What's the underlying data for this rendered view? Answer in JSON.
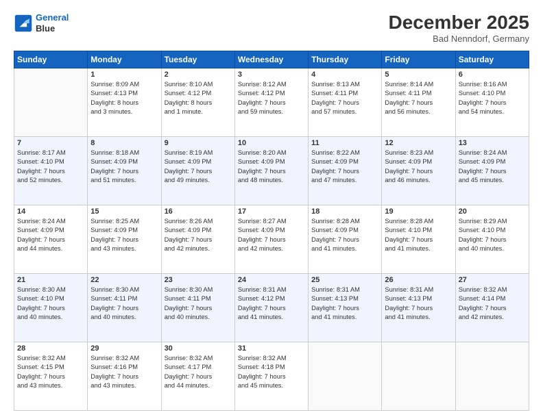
{
  "header": {
    "logo_line1": "General",
    "logo_line2": "Blue",
    "title": "December 2025",
    "subtitle": "Bad Nenndorf, Germany"
  },
  "days_of_week": [
    "Sunday",
    "Monday",
    "Tuesday",
    "Wednesday",
    "Thursday",
    "Friday",
    "Saturday"
  ],
  "weeks": [
    [
      {
        "day": "",
        "info": ""
      },
      {
        "day": "1",
        "info": "Sunrise: 8:09 AM\nSunset: 4:13 PM\nDaylight: 8 hours\nand 3 minutes."
      },
      {
        "day": "2",
        "info": "Sunrise: 8:10 AM\nSunset: 4:12 PM\nDaylight: 8 hours\nand 1 minute."
      },
      {
        "day": "3",
        "info": "Sunrise: 8:12 AM\nSunset: 4:12 PM\nDaylight: 7 hours\nand 59 minutes."
      },
      {
        "day": "4",
        "info": "Sunrise: 8:13 AM\nSunset: 4:11 PM\nDaylight: 7 hours\nand 57 minutes."
      },
      {
        "day": "5",
        "info": "Sunrise: 8:14 AM\nSunset: 4:11 PM\nDaylight: 7 hours\nand 56 minutes."
      },
      {
        "day": "6",
        "info": "Sunrise: 8:16 AM\nSunset: 4:10 PM\nDaylight: 7 hours\nand 54 minutes."
      }
    ],
    [
      {
        "day": "7",
        "info": "Sunrise: 8:17 AM\nSunset: 4:10 PM\nDaylight: 7 hours\nand 52 minutes."
      },
      {
        "day": "8",
        "info": "Sunrise: 8:18 AM\nSunset: 4:09 PM\nDaylight: 7 hours\nand 51 minutes."
      },
      {
        "day": "9",
        "info": "Sunrise: 8:19 AM\nSunset: 4:09 PM\nDaylight: 7 hours\nand 49 minutes."
      },
      {
        "day": "10",
        "info": "Sunrise: 8:20 AM\nSunset: 4:09 PM\nDaylight: 7 hours\nand 48 minutes."
      },
      {
        "day": "11",
        "info": "Sunrise: 8:22 AM\nSunset: 4:09 PM\nDaylight: 7 hours\nand 47 minutes."
      },
      {
        "day": "12",
        "info": "Sunrise: 8:23 AM\nSunset: 4:09 PM\nDaylight: 7 hours\nand 46 minutes."
      },
      {
        "day": "13",
        "info": "Sunrise: 8:24 AM\nSunset: 4:09 PM\nDaylight: 7 hours\nand 45 minutes."
      }
    ],
    [
      {
        "day": "14",
        "info": "Sunrise: 8:24 AM\nSunset: 4:09 PM\nDaylight: 7 hours\nand 44 minutes."
      },
      {
        "day": "15",
        "info": "Sunrise: 8:25 AM\nSunset: 4:09 PM\nDaylight: 7 hours\nand 43 minutes."
      },
      {
        "day": "16",
        "info": "Sunrise: 8:26 AM\nSunset: 4:09 PM\nDaylight: 7 hours\nand 42 minutes."
      },
      {
        "day": "17",
        "info": "Sunrise: 8:27 AM\nSunset: 4:09 PM\nDaylight: 7 hours\nand 42 minutes."
      },
      {
        "day": "18",
        "info": "Sunrise: 8:28 AM\nSunset: 4:09 PM\nDaylight: 7 hours\nand 41 minutes."
      },
      {
        "day": "19",
        "info": "Sunrise: 8:28 AM\nSunset: 4:10 PM\nDaylight: 7 hours\nand 41 minutes."
      },
      {
        "day": "20",
        "info": "Sunrise: 8:29 AM\nSunset: 4:10 PM\nDaylight: 7 hours\nand 40 minutes."
      }
    ],
    [
      {
        "day": "21",
        "info": "Sunrise: 8:30 AM\nSunset: 4:10 PM\nDaylight: 7 hours\nand 40 minutes."
      },
      {
        "day": "22",
        "info": "Sunrise: 8:30 AM\nSunset: 4:11 PM\nDaylight: 7 hours\nand 40 minutes."
      },
      {
        "day": "23",
        "info": "Sunrise: 8:30 AM\nSunset: 4:11 PM\nDaylight: 7 hours\nand 40 minutes."
      },
      {
        "day": "24",
        "info": "Sunrise: 8:31 AM\nSunset: 4:12 PM\nDaylight: 7 hours\nand 41 minutes."
      },
      {
        "day": "25",
        "info": "Sunrise: 8:31 AM\nSunset: 4:13 PM\nDaylight: 7 hours\nand 41 minutes."
      },
      {
        "day": "26",
        "info": "Sunrise: 8:31 AM\nSunset: 4:13 PM\nDaylight: 7 hours\nand 41 minutes."
      },
      {
        "day": "27",
        "info": "Sunrise: 8:32 AM\nSunset: 4:14 PM\nDaylight: 7 hours\nand 42 minutes."
      }
    ],
    [
      {
        "day": "28",
        "info": "Sunrise: 8:32 AM\nSunset: 4:15 PM\nDaylight: 7 hours\nand 43 minutes."
      },
      {
        "day": "29",
        "info": "Sunrise: 8:32 AM\nSunset: 4:16 PM\nDaylight: 7 hours\nand 43 minutes."
      },
      {
        "day": "30",
        "info": "Sunrise: 8:32 AM\nSunset: 4:17 PM\nDaylight: 7 hours\nand 44 minutes."
      },
      {
        "day": "31",
        "info": "Sunrise: 8:32 AM\nSunset: 4:18 PM\nDaylight: 7 hours\nand 45 minutes."
      },
      {
        "day": "",
        "info": ""
      },
      {
        "day": "",
        "info": ""
      },
      {
        "day": "",
        "info": ""
      }
    ]
  ]
}
